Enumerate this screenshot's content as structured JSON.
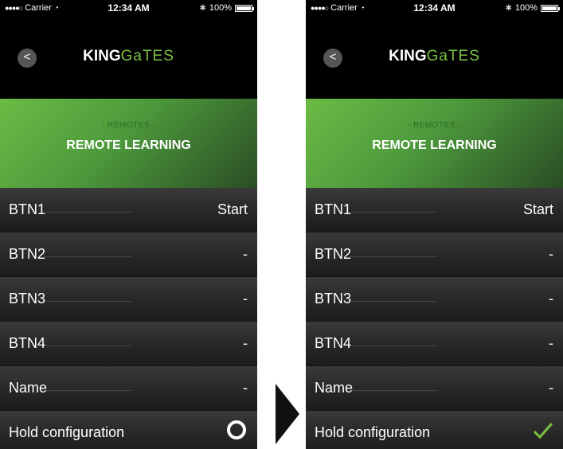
{
  "status": {
    "carrier": "Carrier",
    "time": "12:34 AM",
    "battery": "100%"
  },
  "header": {
    "logo_bold": "KING",
    "logo_light": "GaTES"
  },
  "banner": {
    "subtitle": "- REMOTES -",
    "title": "REMOTE LEARNING"
  },
  "rows": [
    {
      "label": "BTN1",
      "value": "Start"
    },
    {
      "label": "BTN2",
      "value": "-"
    },
    {
      "label": "BTN3",
      "value": "-"
    },
    {
      "label": "BTN4",
      "value": "-"
    },
    {
      "label": "Name",
      "value": "-"
    }
  ],
  "hold": {
    "label": "Hold configuration",
    "left_state": "unchecked",
    "right_state": "checked"
  },
  "colors": {
    "accent_green": "#7cc142",
    "banner_green": "#5aac3f",
    "background": "#000000"
  }
}
